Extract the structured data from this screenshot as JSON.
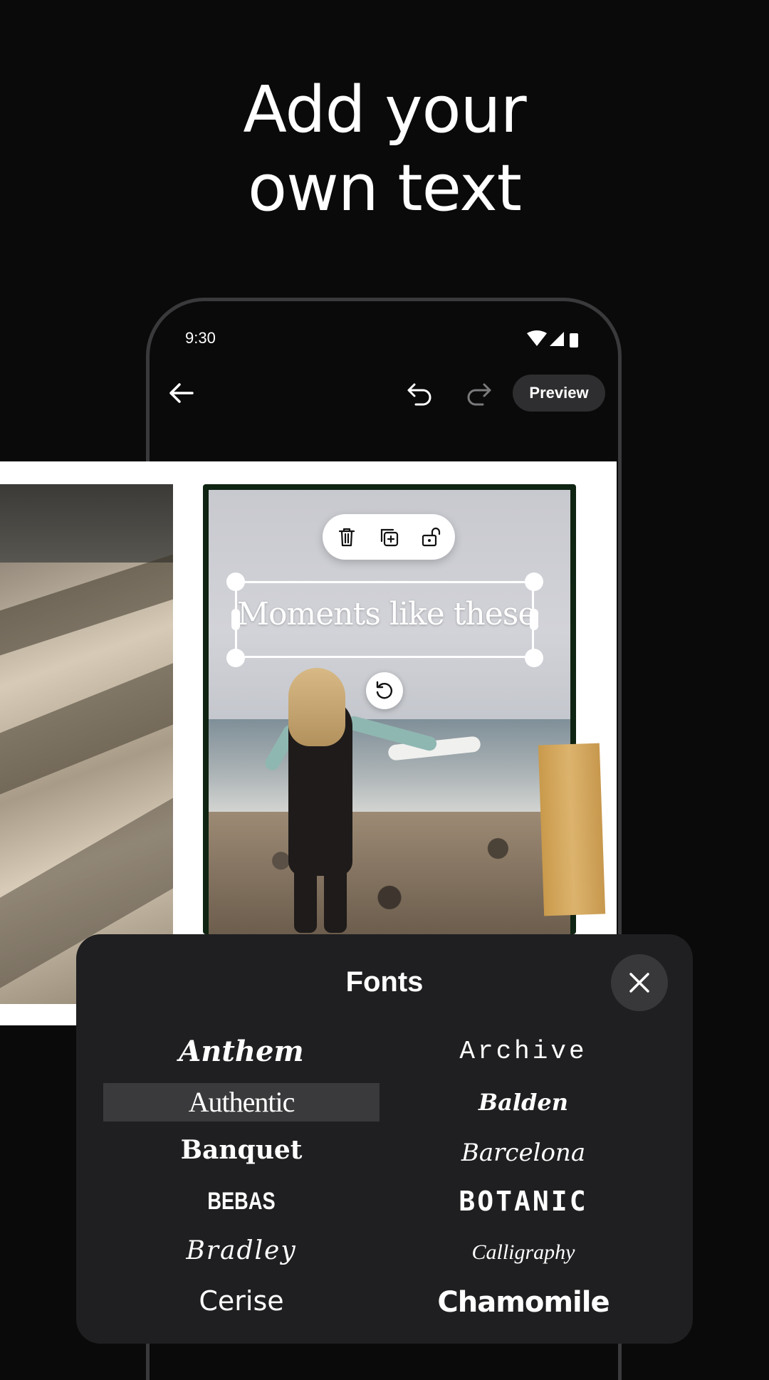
{
  "headline": {
    "line1": "Add your",
    "line2": "own text"
  },
  "status_bar": {
    "time": "9:30"
  },
  "toolbar": {
    "preview_label": "Preview"
  },
  "canvas": {
    "text_overlay": "Moments like these"
  },
  "fonts_sheet": {
    "title": "Fonts",
    "selected": "Authentic",
    "items": [
      {
        "name": "Anthem"
      },
      {
        "name": "Archive"
      },
      {
        "name": "Authentic"
      },
      {
        "name": "Balden"
      },
      {
        "name": "Banquet"
      },
      {
        "name": "Barcelona"
      },
      {
        "name": "BEBAS"
      },
      {
        "name": "BOTANIC"
      },
      {
        "name": "Bradley"
      },
      {
        "name": "Calligraphy"
      },
      {
        "name": "Cerise"
      },
      {
        "name": "Chamomile"
      }
    ]
  },
  "colors": {
    "background": "#0a0a0a",
    "sheet": "#1f1f21",
    "button": "#2e2e30"
  }
}
